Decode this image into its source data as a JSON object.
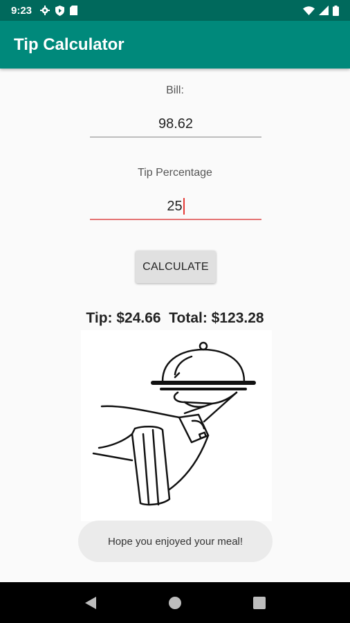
{
  "status_bar": {
    "time": "9:23",
    "icons_left": [
      "gear-icon",
      "shield-icon",
      "sd-card-icon"
    ],
    "icons_right": [
      "wifi-icon",
      "signal-icon",
      "battery-icon"
    ]
  },
  "app_bar": {
    "title": "Tip Calculator",
    "color": "#00897b",
    "status_color": "#00695c"
  },
  "form": {
    "bill_label": "Bill:",
    "bill_value": "98.62",
    "tip_label": "Tip Percentage",
    "tip_value": "25",
    "calculate_label": "CALCULATE"
  },
  "result": {
    "text": "Tip: $24.66  Total: $123.28"
  },
  "illustration": {
    "icon": "waiter-serving-cloche-icon"
  },
  "toast": {
    "message": "Hope you enjoyed your meal!"
  },
  "nav_bar": {
    "buttons": [
      "back-icon",
      "home-icon",
      "recents-icon"
    ]
  }
}
